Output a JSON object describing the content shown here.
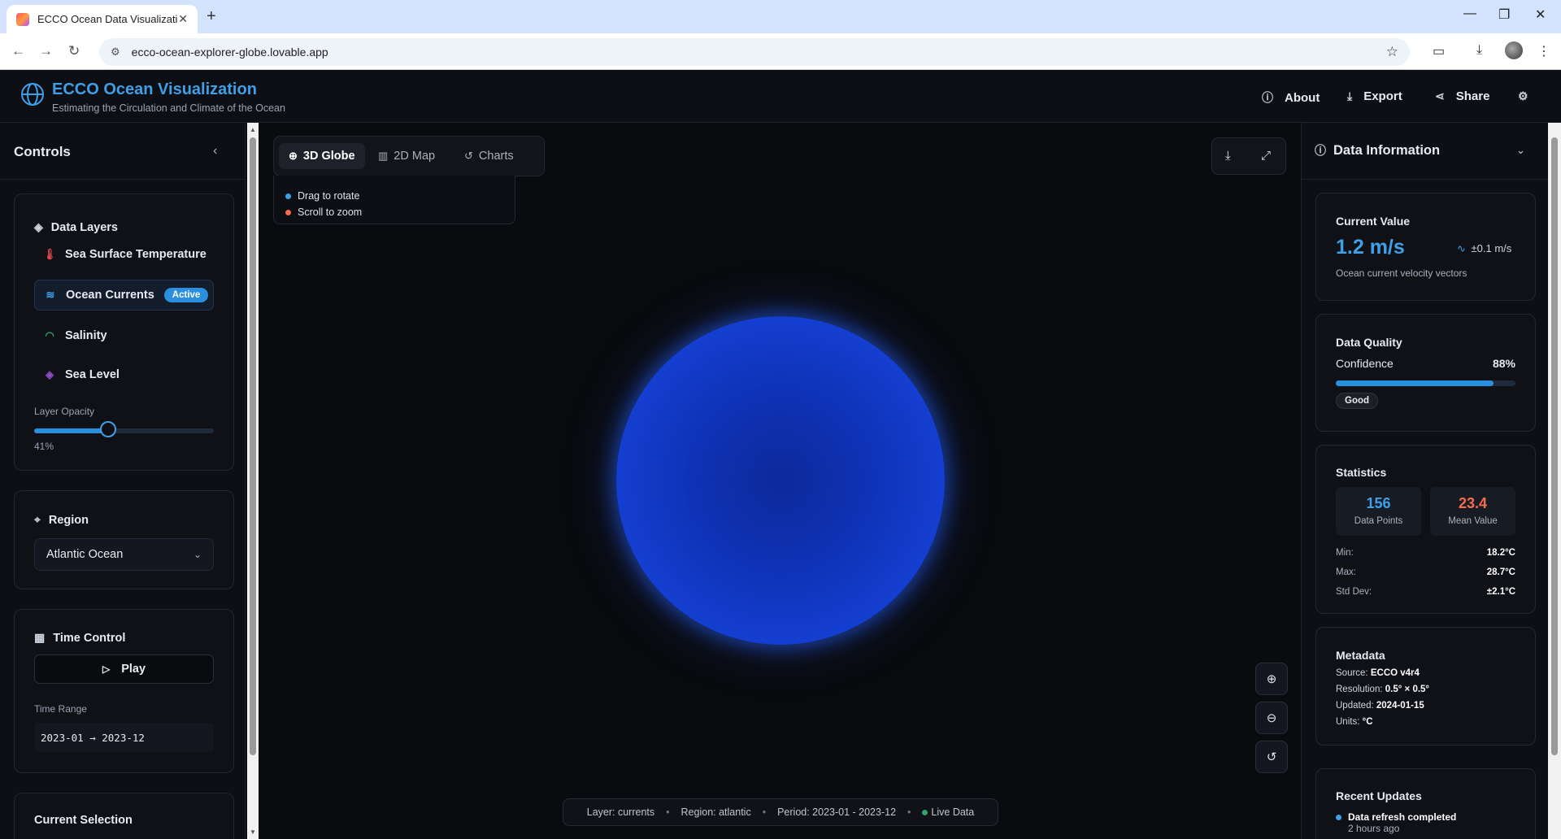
{
  "browser": {
    "tab_title": "ECCO Ocean Data Visualization",
    "url": "ecco-ocean-explorer-globe.lovable.app"
  },
  "header": {
    "title": "ECCO Ocean Visualization",
    "subtitle": "Estimating the Circulation and Climate of the Ocean",
    "about_label": "About",
    "export_label": "Export",
    "share_label": "Share"
  },
  "sidebar": {
    "title": "Controls",
    "layers_title": "Data Layers",
    "layers": [
      {
        "label": "Sea Surface Temperature",
        "icon": "thermometer-icon",
        "color": "#e5484d"
      },
      {
        "label": "Ocean Currents",
        "icon": "waves-icon",
        "color": "#3fa0e8",
        "badge": "Active"
      },
      {
        "label": "Salinity",
        "icon": "gauge-icon",
        "color": "#30a46c"
      },
      {
        "label": "Sea Level",
        "icon": "layers-icon",
        "color": "#8e4ec6"
      }
    ],
    "opacity_label": "Layer Opacity",
    "opacity_value": 0.41,
    "opacity_text": "41%",
    "region_title": "Region",
    "region_selected": "Atlantic Ocean",
    "time_title": "Time Control",
    "play_label": "Play",
    "time_range_label": "Time Range",
    "time_range_value": "2023-01 → 2023-12",
    "selection_title": "Current Selection"
  },
  "main": {
    "tabs": [
      {
        "label": "3D Globe",
        "selected": true
      },
      {
        "label": "2D Map",
        "selected": false
      },
      {
        "label": "Charts",
        "selected": false
      }
    ],
    "hints": [
      {
        "text": "Drag to rotate",
        "color": "#3fa0e8"
      },
      {
        "text": "Scroll to zoom",
        "color": "#f76b4f"
      }
    ],
    "status": {
      "layer": "Layer: currents",
      "region": "Region: atlantic",
      "period": "Period: 2023-01 - 2023-12",
      "live": "Live Data",
      "live_color": "#30a46c"
    }
  },
  "panel": {
    "title": "Data Information",
    "current": {
      "heading": "Current Value",
      "value": "1.2 m/s",
      "delta": "±0.1 m/s",
      "description": "Ocean current velocity vectors"
    },
    "quality": {
      "heading": "Data Quality",
      "label": "Confidence",
      "value_text": "88%",
      "value": 0.88,
      "badge": "Good"
    },
    "statistics": {
      "heading": "Statistics",
      "points": "156",
      "points_label": "Data Points",
      "mean": "23.4",
      "mean_label": "Mean Value",
      "mean_color": "#f76b4f",
      "rows": [
        {
          "label": "Min:",
          "value": "18.2°C"
        },
        {
          "label": "Max:",
          "value": "28.7°C"
        },
        {
          "label": "Std Dev:",
          "value": "±2.1°C"
        }
      ]
    },
    "metadata": {
      "heading": "Metadata",
      "rows": [
        {
          "label": "Source:",
          "value": "ECCO v4r4"
        },
        {
          "label": "Resolution:",
          "value": "0.5° × 0.5°"
        },
        {
          "label": "Updated:",
          "value": "2024-01-15"
        },
        {
          "label": "Units:",
          "value": "°C"
        }
      ]
    },
    "updates": {
      "heading": "Recent Updates",
      "items": [
        {
          "title": "Data refresh completed",
          "time": "2 hours ago"
        }
      ]
    }
  }
}
